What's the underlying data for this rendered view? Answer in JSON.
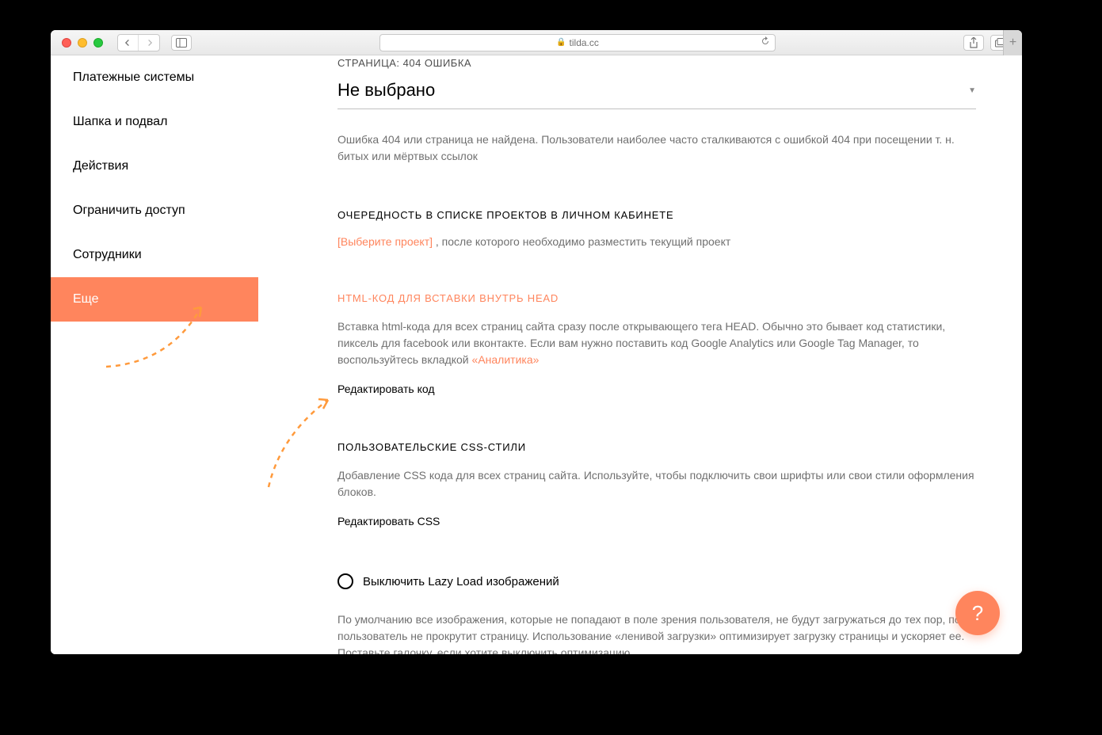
{
  "browser": {
    "url": "tilda.cc"
  },
  "sidebar": {
    "items": [
      {
        "label": "Платежные системы"
      },
      {
        "label": "Шапка и подвал"
      },
      {
        "label": "Действия"
      },
      {
        "label": "Ограничить доступ"
      },
      {
        "label": "Сотрудники"
      },
      {
        "label": "Еще"
      }
    ]
  },
  "section_404": {
    "label": "СТРАНИЦА: 404 ОШИБКА",
    "dropdown_value": "Не выбрано",
    "description": "Ошибка 404 или страница не найдена. Пользователи наиболее часто сталкиваются с ошибкой 404 при посещении т. н. битых или мёртвых ссылок"
  },
  "section_order": {
    "heading": "ОЧЕРЕДНОСТЬ В СПИСКЕ ПРОЕКТОВ В ЛИЧНОМ КАБИНЕТЕ",
    "select_label": "[Выберите проект]",
    "after_text": " , после которого необходимо разместить текущий проект"
  },
  "section_head": {
    "heading": "HTML-КОД ДЛЯ ВСТАВКИ ВНУТРЬ HEAD",
    "description_1": "Вставка html-кода для всех страниц сайта сразу после открывающего тега HEAD. Обычно это бывает код статистики, пиксель для facebook или вконтакте. Если вам нужно поставить код Google Analytics или Google Tag Manager, то воспользуйтесь вкладкой ",
    "analytics_link": "«Аналитика»",
    "edit_label": "Редактировать код"
  },
  "section_css": {
    "heading": "ПОЛЬЗОВАТЕЛЬСКИЕ CSS-СТИЛИ",
    "description": "Добавление CSS кода для всех страниц сайта. Используйте, чтобы подключить свои шрифты или свои стили оформления блоков.",
    "edit_label": "Редактировать CSS"
  },
  "section_lazy": {
    "checkbox_label": "Выключить Lazy Load изображений",
    "description": "По умолчанию все изображения, которые не попадают в поле зрения пользователя, не будут загружаться до тех пор, пока пользователь не прокрутит страницу. Использование «ленивой загрузки» оптимизирует загрузку страницы и ускоряет ее. Поставьте галочку, если хотите выключить оптимизацию."
  },
  "help": {
    "label": "?"
  }
}
